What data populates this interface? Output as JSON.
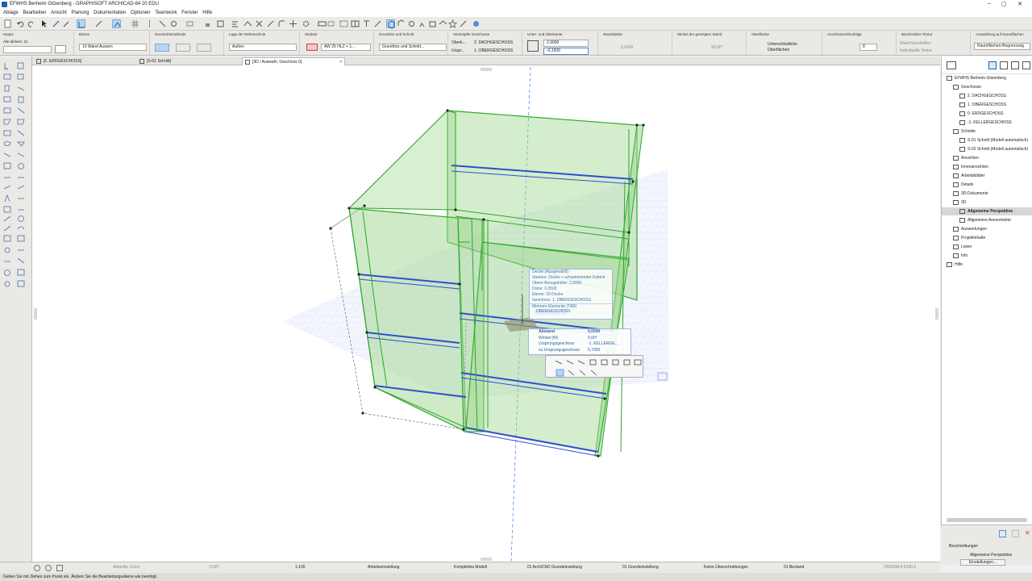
{
  "window": {
    "title": "EFWHS Berheim Gitzenberg - GRAPHISOFT ARCHICAD-64 20 EDU",
    "controls": [
      "–",
      "▢",
      "✕"
    ]
  },
  "menu": [
    "Ablage",
    "Bearbeiten",
    "Ansicht",
    "Planung",
    "Dokumentation",
    "Optionen",
    "Teamwork",
    "Fenster",
    "Hilfe"
  ],
  "infobox": {
    "haupt_label": "Haupt:",
    "alle_aktiven": "Alle aktiven: 21",
    "ebene_label": "Ebene",
    "ebene_value": "10 Wand Aussen",
    "geometrie_label": "Geometriemethode",
    "referenz_label": "Lage der Referenzlinie",
    "referenz_value": "Außen",
    "struktur_label": "Struktur",
    "struktur_value": "AW 25 HLZ + 1...",
    "grundriss_label": "Grundriss und Schnitt",
    "grundriss_value": "Grundriss und Schnitt...",
    "geschosse_label": "Verknüpfte Geschosse",
    "oberk_label": "Oberk...",
    "oberk_value": "2. DACHGESCHOSS",
    "urspr_label": "Urspr...",
    "urspr_value": "1. OBERGESCHOSS",
    "unter_ober_label": "Unter- und Oberkante",
    "oberkante_value": "2,9000",
    "unterkante_value": "-0,1500",
    "wandstaerke_label": "Wandstärke",
    "wandstaerke_value": "0,4300",
    "winkel_label": "Winkel der geneigten Wand",
    "winkel_value": "90,00°",
    "oberflaeche_label": "Oberfläche",
    "oberflaeche_value_1": "Unterschiedliche",
    "oberflaeche_value_2": "Oberflächen",
    "anschluss_label": "Anschlussreihenfolge",
    "anschluss_value": "8",
    "beschreiben_label": "Beschreiben Textur",
    "wand_beschriften": "Wand beschriften",
    "individuelle_textur": "Individuelle Textur",
    "auswahl_label": "Auswahlung auf Raumflächen",
    "auswahl_value": "Raumflächen-Begrenzung"
  },
  "tabs": [
    {
      "label": "[0. ERDGESCHOSS]"
    },
    {
      "label": "[S-01 Schnitt]"
    },
    {
      "label": "[3D / Auswahl, Geschoss 0]"
    }
  ],
  "tooltip": {
    "lines": [
      "Decke (Ausgewählt)",
      "Struktur: Decke + schwimmender Estrich",
      "Obere Bezugshöhe: 2,9000",
      "Dicke: 0,3500",
      "Ebene: 20 Decke",
      "Geschoss: 1. OBERGESCHOSS"
    ],
    "multi": "Mehrere Elemente (TAB)",
    "selected": "OBERGESCHOSS"
  },
  "tracker": {
    "rows": [
      {
        "label": "Abstand",
        "value": "0,0000"
      },
      {
        "label": "Winkel (W)",
        "value": "0,00°"
      },
      {
        "label": "Ursprungsgeschoss",
        "value": "-1. KELLERGE..."
      },
      {
        "label": "zu Ursprungsgeschoss",
        "value": "5,7000"
      }
    ]
  },
  "navigator": {
    "root": "EFWHS Berheim Gitzenberg",
    "items": [
      {
        "label": "Geschosse"
      },
      {
        "label": "2. DACHGESCHOSS"
      },
      {
        "label": "1. OBERGESCHOSS"
      },
      {
        "label": "0. ERDGESCHOSS"
      },
      {
        "label": "-1. KELLERGESCHOSS"
      },
      {
        "label": "Schnitte"
      },
      {
        "label": "S-01 Schnitt (Modell automatisch)"
      },
      {
        "label": "S-02 Schnitt (Modell automatisch)"
      },
      {
        "label": "Ansichten"
      },
      {
        "label": "Innenansichten"
      },
      {
        "label": "Arbeitsblätter"
      },
      {
        "label": "Details"
      },
      {
        "label": "3D-Dokumente"
      },
      {
        "label": "3D"
      },
      {
        "label": "Allgemeine Perspektive"
      },
      {
        "label": "Allgemeine Axonometrie"
      },
      {
        "label": "Auswertungen"
      },
      {
        "label": "Projektinhalte"
      },
      {
        "label": "Listen"
      },
      {
        "label": "Info"
      },
      {
        "label": "Hilfe"
      }
    ],
    "beschreibungen": "Beschreibungen",
    "current_view": "Allgemeine Perspektive",
    "einstellungen": "Einstellungen..."
  },
  "statusbar": {
    "zoom": "Aktueller Zoom",
    "angle": "0,00°",
    "scale": "1:100",
    "layer": "Arbeitseinstellung",
    "model": "Komplettes Modell",
    "pen": "01 ArchiCAD Grundeinstellung",
    "graphic": "01 Grundeinstellung",
    "dims": "Keine Überschreibungen",
    "reno": "01 Bestand",
    "norm": "ÖNORM A 6240-2"
  },
  "hint": "Geben Sie mit Ziehen zum Punkt ein. Ändern Sie die Bearbeitungsebene wie benötigt.",
  "colors": {
    "wall_fill": "#9fd68f",
    "wall_edge": "#2fa82a",
    "slab_edge": "#2f4fd0",
    "grid": "#b9c8ee",
    "selection": "#4d8fe0"
  }
}
